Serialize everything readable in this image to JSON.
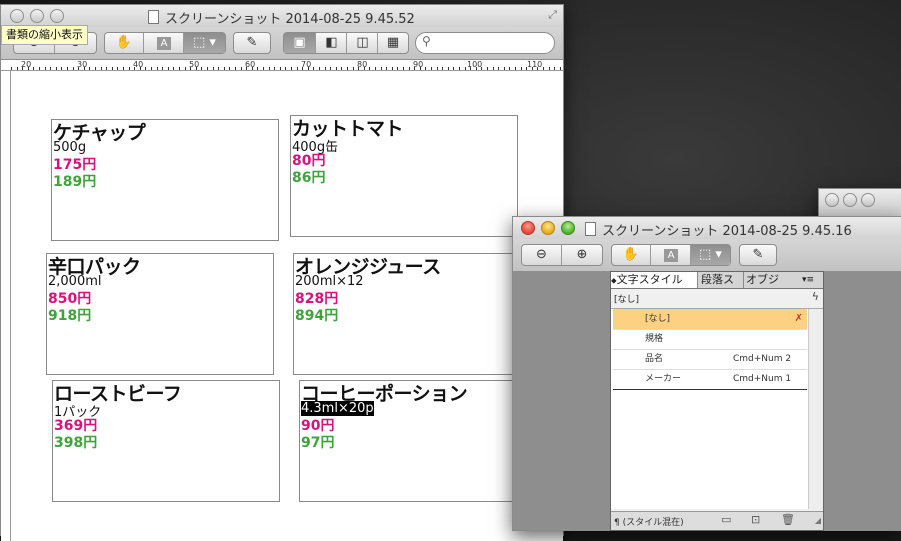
{
  "main_window": {
    "title": "スクリーンショット 2014-08-25 9.45.52",
    "tooltip": "書類の縮小表示",
    "ruler_labels": [
      "20",
      "30",
      "40",
      "50",
      "60",
      "70",
      "80",
      "90",
      "100",
      "110"
    ],
    "products": [
      {
        "name": "ケチャップ",
        "spec": "500g",
        "price_pink": "175円",
        "price_green": "189円"
      },
      {
        "name": "カットトマト",
        "spec": "400g缶",
        "price_pink": "80円",
        "price_green": "86円"
      },
      {
        "name": "辛口パック",
        "spec": "2,000ml",
        "price_pink": "850円",
        "price_green": "918円"
      },
      {
        "name": "オレンジジュース",
        "spec": "200ml×12",
        "price_pink": "828円",
        "price_green": "894円"
      },
      {
        "name": "ローストビーフ",
        "spec": "1パック",
        "price_pink": "369円",
        "price_green": "398円"
      },
      {
        "name": "コーヒーポーション",
        "spec": "4.3ml×20p",
        "price_pink": "90円",
        "price_green": "97円"
      }
    ]
  },
  "second_window": {
    "title": "スクリーンショット 2014-08-25 9.45.16",
    "panel": {
      "tabs": [
        "文字スタイル",
        "段落ス",
        "オブジ"
      ],
      "current_style": "[なし]",
      "rows": [
        {
          "name": "[なし]",
          "shortcut": ""
        },
        {
          "name": "規格",
          "shortcut": ""
        },
        {
          "name": "品名",
          "shortcut": "Cmd+Num 2"
        },
        {
          "name": "メーカー",
          "shortcut": "Cmd+Num 1"
        }
      ],
      "footer": "¶ (スタイル混在)"
    }
  },
  "icons": {
    "zoom_out": "magnifier-minus-icon",
    "zoom_in": "magnifier-plus-icon",
    "hand": "hand-icon",
    "text": "text-tool-icon",
    "select": "selection-icon",
    "pen": "pencil-icon",
    "search": "search-icon"
  }
}
